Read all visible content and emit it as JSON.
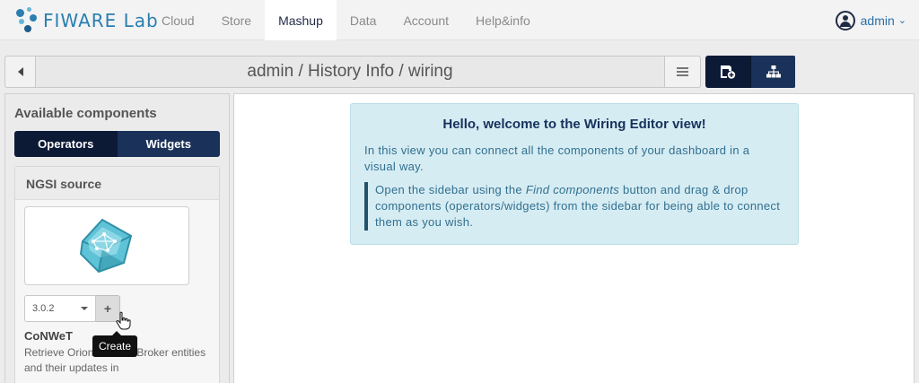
{
  "app": {
    "brand": "FIWARE Lab",
    "brand_accent": "#2a7fb0"
  },
  "navbar": {
    "items": [
      {
        "label": "Cloud"
      },
      {
        "label": "Store"
      },
      {
        "label": "Mashup",
        "active": true
      },
      {
        "label": "Data"
      },
      {
        "label": "Account"
      },
      {
        "label": "Help&info"
      }
    ],
    "user": {
      "name": "admin",
      "icon": "user-circle-icon"
    }
  },
  "breadcrumb": {
    "title": "admin / History Info / wiring",
    "back_icon": "chevron-left-icon",
    "menu_icon": "hamburger-icon"
  },
  "toolbar": {
    "find_components_icon": "find-components-icon",
    "behaviours_icon": "sitemap-icon"
  },
  "sidebar": {
    "title": "Available components",
    "tabs": [
      {
        "label": "Operators",
        "active": true
      },
      {
        "label": "Widgets",
        "active": false
      }
    ],
    "component": {
      "name": "NGSI source",
      "version": "3.0.2",
      "add_label": "+",
      "vendor": "CoNWeT",
      "description": "Retrieve Orion Context Broker entities and their updates in",
      "tooltip": "Create"
    }
  },
  "main": {
    "alert": {
      "title": "Hello, welcome to the Wiring Editor view!",
      "paragraph": "In this view you can connect all the components of your dashboard in a visual way.",
      "quote_pre": "Open the sidebar using the ",
      "quote_em": "Find components",
      "quote_post": " button and drag & drop components (operators/widgets) from the sidebar for being able to connect them as you wish."
    }
  },
  "colors": {
    "navy": "#1a3259",
    "navy_active": "#0c1a36",
    "alert_bg": "#d6ecf3",
    "alert_text": "#31708f"
  }
}
